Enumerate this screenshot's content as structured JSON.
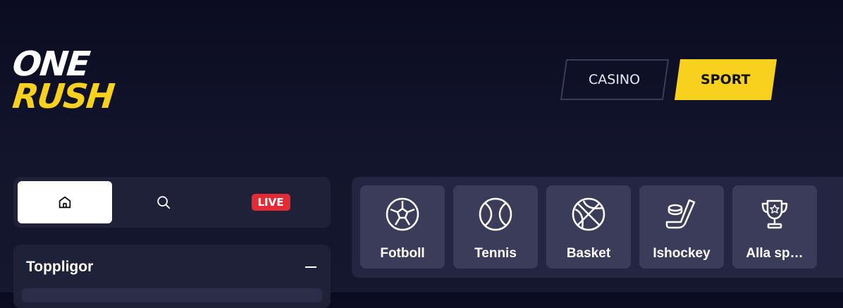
{
  "brand": {
    "line1": "ONE",
    "line2": "RUSH"
  },
  "modes": {
    "casino": "CASINO",
    "sport": "SPORT"
  },
  "nav": {
    "live": "LIVE"
  },
  "sports": [
    {
      "label": "Fotboll",
      "icon": "soccer-ball-icon"
    },
    {
      "label": "Tennis",
      "icon": "tennis-ball-icon"
    },
    {
      "label": "Basket",
      "icon": "basketball-icon"
    },
    {
      "label": "Ishockey",
      "icon": "hockey-icon"
    },
    {
      "label": "Alla sp…",
      "icon": "trophy-icon"
    }
  ],
  "leagues": {
    "title": "Toppligor"
  },
  "colors": {
    "accent": "#f7d11e",
    "live": "#e32b36",
    "tile": "#3b3c5a",
    "panel": "#1f2138"
  }
}
